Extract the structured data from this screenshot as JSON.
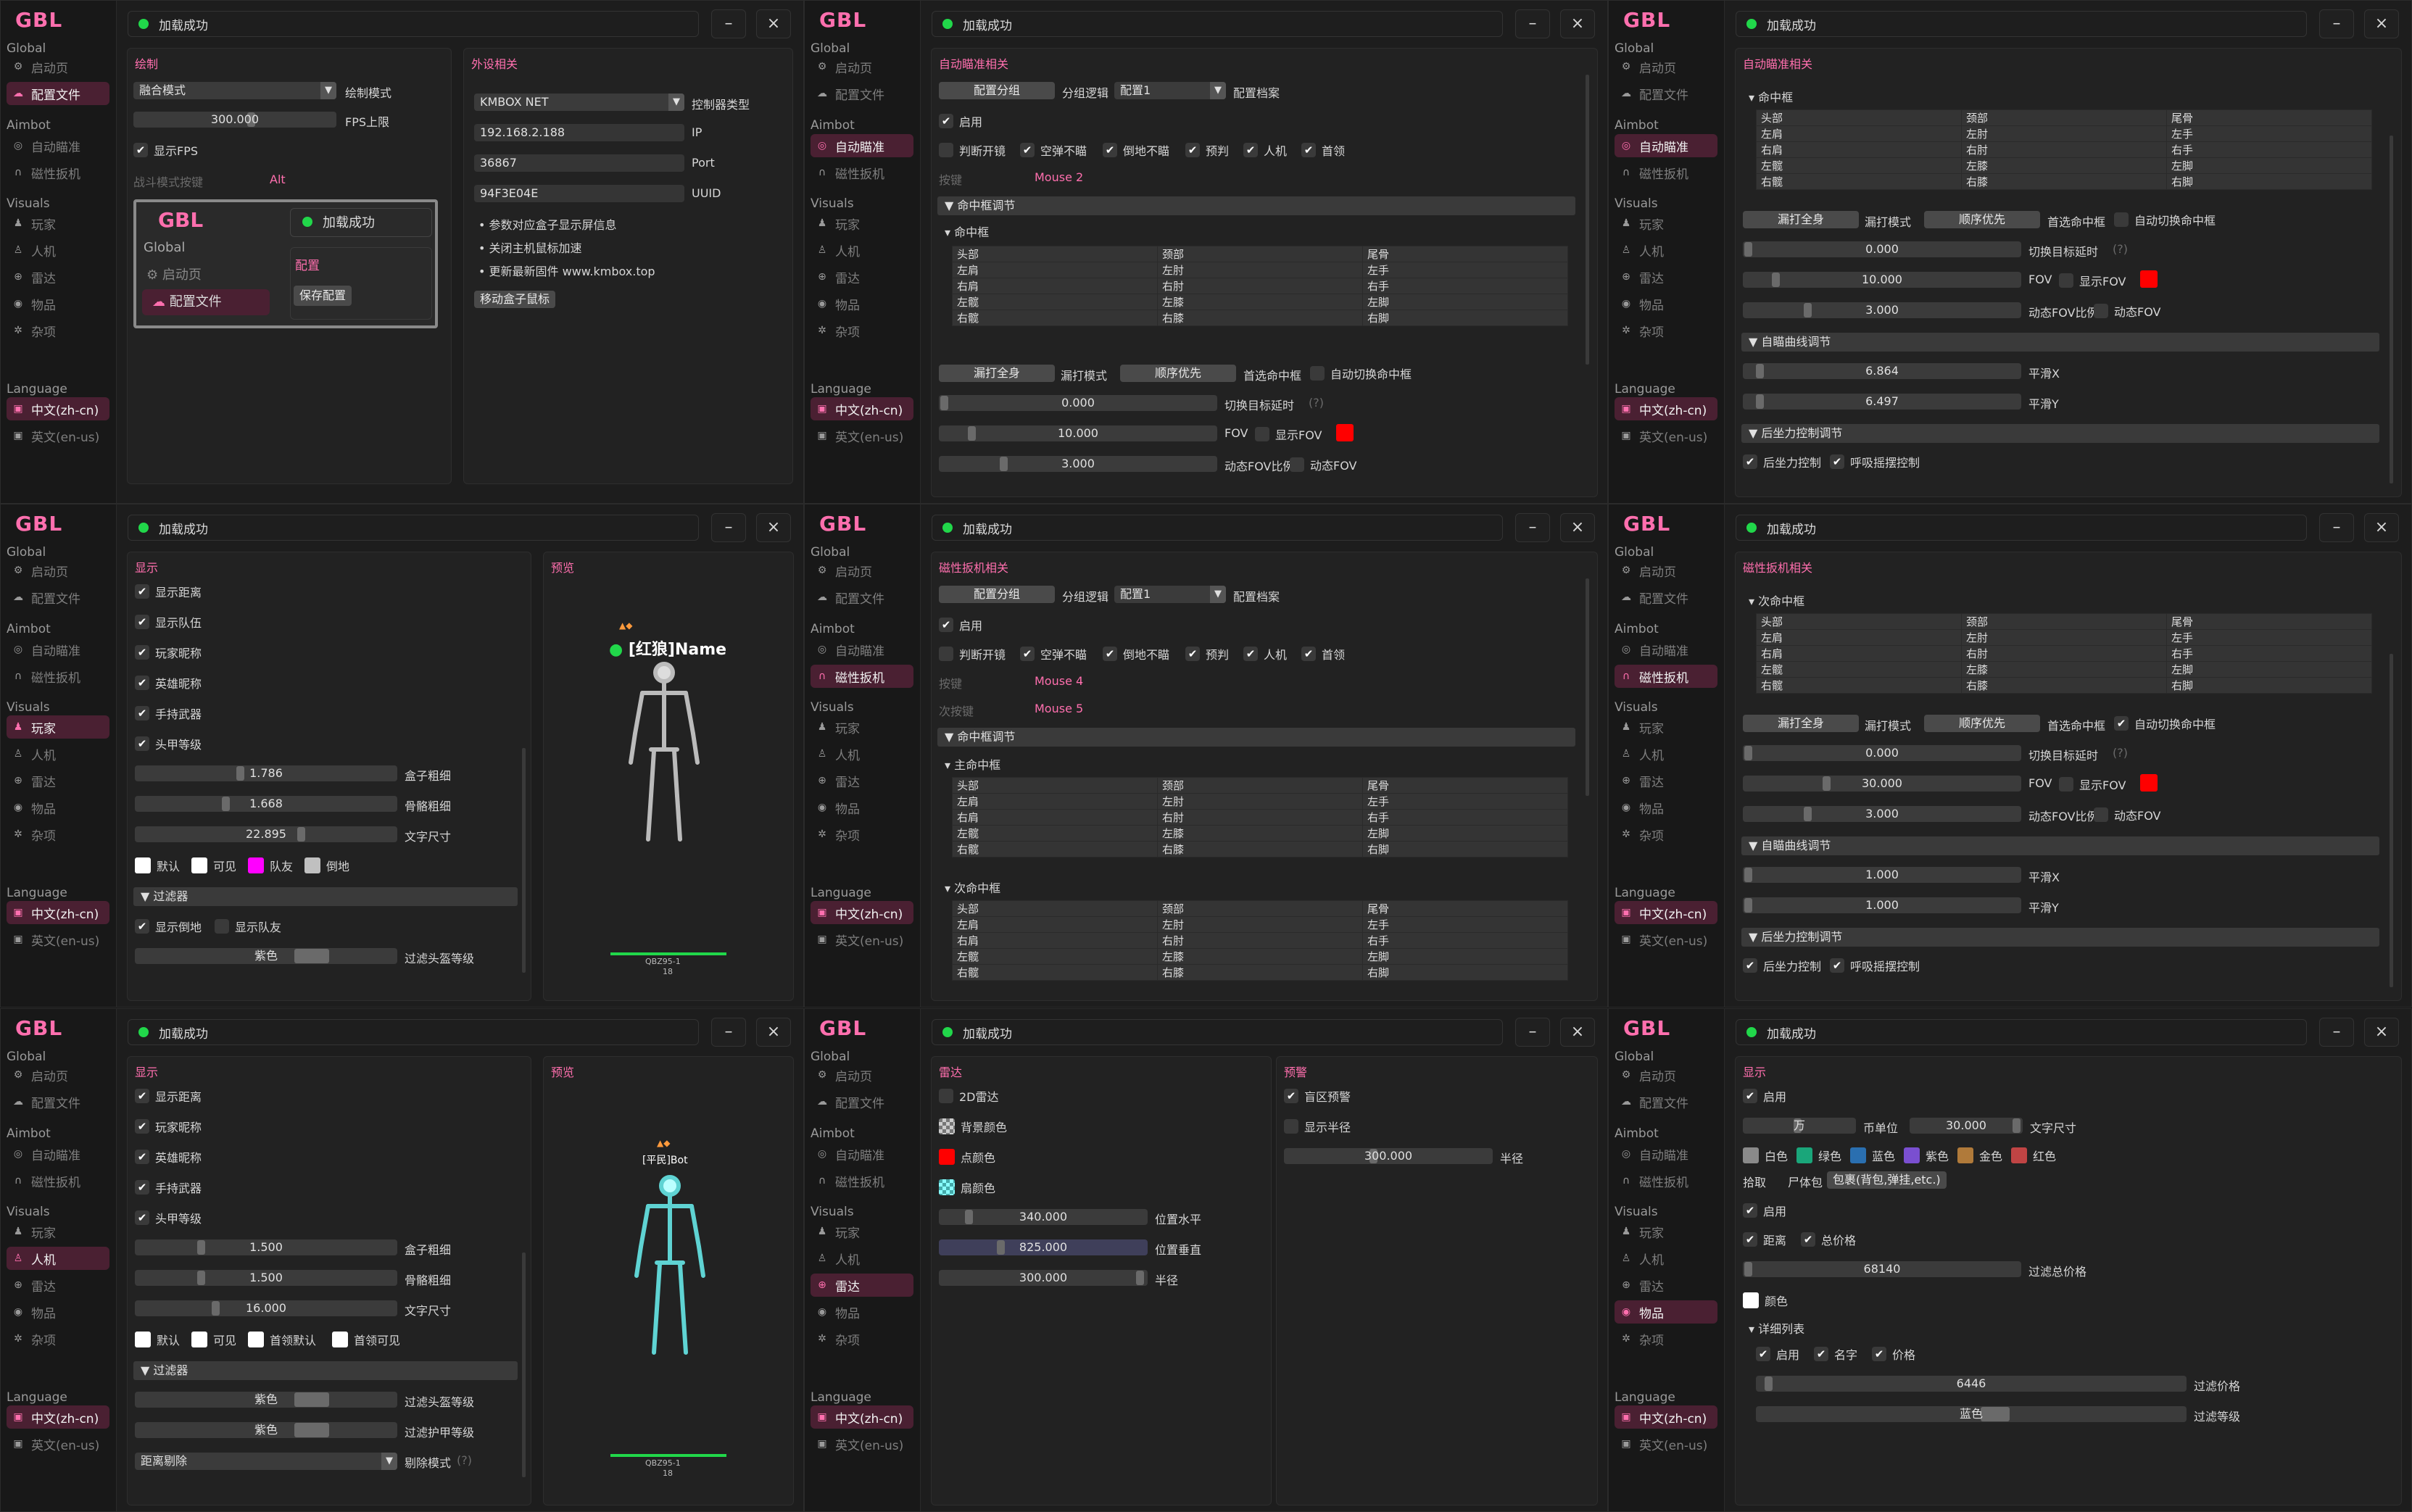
{
  "app": {
    "logo": "GBL",
    "status": "加载成功",
    "minimize": "–",
    "close": "×",
    "sections": {
      "global": "Global",
      "aimbot": "Aimbot",
      "visuals": "Visuals",
      "language": "Language"
    },
    "nav": {
      "startup": "启动页",
      "config": "配置文件",
      "autoaim": "自动瞄准",
      "trigger": "磁性扳机",
      "player": "玩家",
      "bot": "人机",
      "radar": "雷达",
      "items": "物品",
      "misc": "杂项",
      "zh": "中文(zh-cn)",
      "en": "英文(en-us)"
    }
  },
  "p1": {
    "draw": {
      "title": "绘制",
      "mode": "融合模式",
      "mode_lbl": "绘制模式",
      "fps": "300.000",
      "fps_lbl": "FPS上限",
      "show_fps": "显示FPS",
      "battle_key": "战斗模式按键",
      "battle_val": "Alt"
    },
    "device": {
      "title": "外设相关",
      "type": "KMBOX NET",
      "type_lbl": "控制器类型",
      "ip": "192.168.2.188",
      "ip_lbl": "IP",
      "port": "36867",
      "port_lbl": "Port",
      "uuid": "94F3E04E",
      "uuid_lbl": "UUID",
      "b1": "参数对应盒子显示屏信息",
      "b2": "关闭主机鼠标加速",
      "b3": "更新最新固件 www.kmbox.top",
      "move": "移动盒子鼠标"
    },
    "popup": {
      "logo": "GBL",
      "status": "加载成功",
      "global": "Global",
      "startup": "启动页",
      "config": "配置文件",
      "cfg_title": "配置",
      "save": "保存配置"
    }
  },
  "aim": {
    "title": "自动瞄准相关",
    "group_btn": "配置分组",
    "group_lbl": "分组逻辑",
    "profile": "配置1",
    "profile_lbl": "配置档案",
    "enable": "启用",
    "judge": "判断开镜",
    "air": "空弹不瞄",
    "down": "倒地不瞄",
    "predict": "预判",
    "bot": "人机",
    "leader": "首领",
    "key": "按键",
    "key_val": "Mouse 2",
    "fov_adjust": "命中框调节",
    "hitbox": "命中框",
    "miss": "漏打全身",
    "miss_lbl": "漏打模式",
    "order": "顺序优先",
    "first_hit": "首选命中框",
    "auto_switch": "自动切换命中框",
    "switch_delay": "0.000",
    "switch_delay_lbl": "切换目标延时",
    "q": "(?)",
    "fov": "10.000",
    "fov_lbl": "FOV",
    "show_fov": "显示FOV",
    "dyn": "3.000",
    "dyn_lbl": "动态FOV比例",
    "dyn_fov": "动态FOV",
    "curve": "自瞄曲线调节",
    "smooth_x": "6.864",
    "smooth_x_lbl": "平滑X",
    "smooth_y": "6.497",
    "smooth_y_lbl": "平滑Y",
    "recoil_title": "后坐力控制调节",
    "recoil": "后坐力控制",
    "breath": "呼吸摇摆控制"
  },
  "hitbox_rows": [
    [
      "头部",
      "颈部",
      "尾骨"
    ],
    [
      "左肩",
      "左肘",
      "左手"
    ],
    [
      "右肩",
      "右肘",
      "右手"
    ],
    [
      "左髋",
      "左膝",
      "左脚"
    ],
    [
      "右髋",
      "右膝",
      "右脚"
    ]
  ],
  "player": {
    "title": "显示",
    "preview": "预览",
    "dist": "显示距离",
    "team": "显示队伍",
    "nick": "玩家昵称",
    "hero": "英雄昵称",
    "weapon": "手持武器",
    "armor": "头甲等级",
    "box": "1.786",
    "box_lbl": "盒子粗细",
    "bone": "1.668",
    "bone_lbl": "骨骼粗细",
    "text": "22.895",
    "text_lbl": "文字尺寸",
    "c_default": "默认",
    "c_visible": "可见",
    "c_team": "队友",
    "c_down": "倒地",
    "filter": "过滤器",
    "show_down": "显示倒地",
    "show_team": "显示队友",
    "purple": "紫色",
    "helmet": "过滤头盔等级",
    "name": "[红狼]Name",
    "model": "QBZ95-1",
    "model_n": "18"
  },
  "trigger": {
    "title": "磁性扳机相关",
    "key": "按键",
    "key_val": "Mouse 4",
    "key2": "次按键",
    "key2_val": "Mouse 5",
    "main": "主命中框",
    "sub": "次命中框",
    "fov": "30.000",
    "smooth_x": "1.000",
    "smooth_y": "1.000"
  },
  "bot": {
    "box": "1.500",
    "bone": "1.500",
    "text": "16.000",
    "c_leader_default": "首领默认",
    "c_leader_visible": "首领可见",
    "armor_filter": "过滤护甲等级",
    "remove": "距离剔除",
    "remove_lbl": "剔除模式",
    "name": "[平民]Bot",
    "model": "QBZ95-1",
    "model_n": "18"
  },
  "radar": {
    "title": "雷达",
    "radar2d": "2D雷达",
    "bg": "背景颜色",
    "point": "点颜色",
    "fan": "扇颜色",
    "h": "340.000",
    "h_lbl": "位置水平",
    "v": "825.000",
    "v_lbl": "位置垂直",
    "r": "300.000",
    "r_lbl": "半径",
    "warn": "预警",
    "blind": "盲区预警",
    "radius_show": "显示半径",
    "wr": "300.000"
  },
  "items": {
    "title": "显示",
    "enable": "启用",
    "unit": "万",
    "unit_lbl": "币单位",
    "text": "30.000",
    "text_lbl": "文字尺寸",
    "colors": [
      "白色",
      "绿色",
      "蓝色",
      "紫色",
      "金色",
      "红色"
    ],
    "tabs": [
      "拾取",
      "尸体包",
      "包裹(背包,弹挂,etc.)"
    ],
    "enable2": "启用",
    "dist": "距离",
    "total": "总价格",
    "total_val": "68140",
    "total_lbl": "过滤总价格",
    "color": "颜色",
    "detail": "详细列表",
    "d_enable": "启用",
    "d_name": "名字",
    "d_price": "价格",
    "price": "6446",
    "price_lbl": "过滤价格",
    "level": "蓝色",
    "level_lbl": "过滤等级"
  },
  "colors": {
    "accent": "#ff6fae",
    "red": "#ff0000",
    "magenta": "#ff00ff",
    "green": "#21d74a"
  }
}
